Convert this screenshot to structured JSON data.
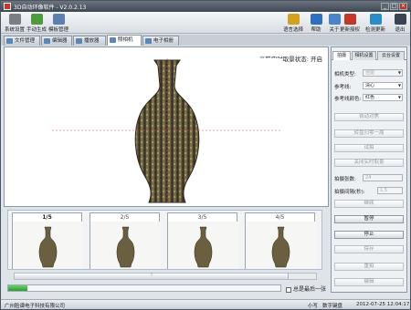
{
  "window": {
    "title": "3D自动环像软件 - V2.0.2.13"
  },
  "toolbar": {
    "left": [
      {
        "label": "系统设置",
        "icon": "gear-icon",
        "color": "#7a7f86"
      },
      {
        "label": "手动生成",
        "icon": "hand-icon",
        "color": "#4f9a3a"
      },
      {
        "label": "模板管理",
        "icon": "template-icon",
        "color": "#5b7fb0"
      }
    ],
    "right": [
      {
        "label": "语言选择",
        "icon": "language-icon",
        "color": "#d4a020"
      },
      {
        "label": "帮助",
        "icon": "help-icon",
        "color": "#2f6fc0"
      },
      {
        "label": "关于",
        "icon": "about-icon",
        "color": "#4c85c7"
      },
      {
        "label": "更新授权",
        "icon": "license-icon",
        "color": "#c0392b"
      },
      {
        "label": "检测更新",
        "icon": "update-icon",
        "color": "#2e8bc9"
      },
      {
        "label": "退出",
        "icon": "exit-icon",
        "color": "#3a4450"
      }
    ]
  },
  "tabs": [
    "文件管理",
    "编辑器",
    "播放器",
    "照相机",
    "电子相册"
  ],
  "active_tab": 3,
  "main": {
    "status": "当前实时取景状态: 开启"
  },
  "thumbnails": [
    "1/5",
    "2/5",
    "3/5",
    "4/5"
  ],
  "progress": {
    "value": 0.07
  },
  "options": {
    "last_label": "总是最后一张"
  },
  "statusbar": {
    "company": "广州脸谱电子科技有限公司",
    "caps": "小写",
    "num": "数字键盘",
    "datetime": "2012-07-25 12:04:17"
  },
  "panel": {
    "tabs": [
      "拍摄",
      "相机设置",
      "云台设置"
    ],
    "fields": [
      {
        "label": "相机类型:",
        "value": "佳能",
        "disabled": true
      },
      {
        "label": "参考线:",
        "value": "清心",
        "disabled": false
      },
      {
        "label": "参考线颜色:",
        "value": "红色",
        "disabled": false
      }
    ],
    "buttons_top": [
      {
        "label": "自动对焦",
        "enabled": false
      },
      {
        "label": "转盘归零一周",
        "enabled": false
      },
      {
        "label": "试拍",
        "enabled": false
      },
      {
        "label": "关闭实时取景",
        "enabled": false
      }
    ],
    "shot_fields": [
      {
        "label": "拍摄张数:",
        "value": "24"
      },
      {
        "label": "拍摄间隔(秒):",
        "value": "1.5"
      }
    ],
    "buttons_bottom": [
      {
        "label": "继续",
        "enabled": false
      },
      {
        "label": "暂停",
        "enabled": true
      },
      {
        "label": "停止",
        "enabled": true
      },
      {
        "label": "保存",
        "enabled": false
      },
      {
        "label": "重拍",
        "enabled": false
      },
      {
        "label": "编辑",
        "enabled": false
      }
    ]
  }
}
